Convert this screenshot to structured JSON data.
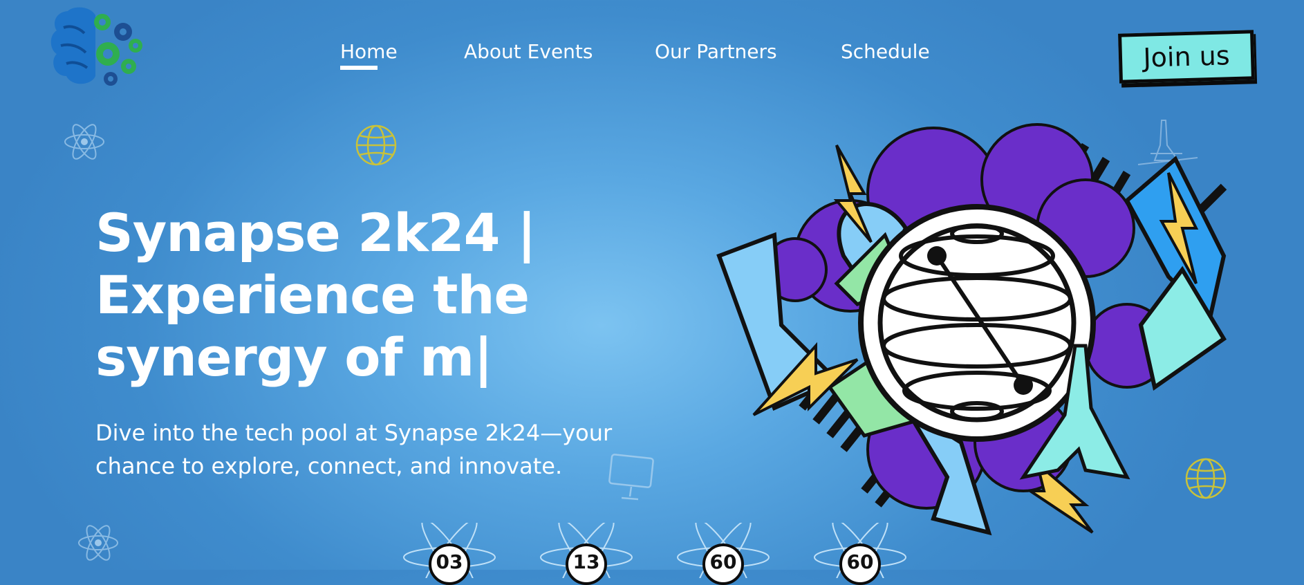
{
  "nav": {
    "items": [
      {
        "label": "Home",
        "active": true
      },
      {
        "label": "About Events",
        "active": false
      },
      {
        "label": "Our Partners",
        "active": false
      },
      {
        "label": "Schedule",
        "active": false
      }
    ],
    "join_label": "Join us"
  },
  "hero": {
    "title_lines": [
      "Synapse 2k24 |",
      "Experience the",
      "synergy of m|"
    ],
    "subtitle_lines": [
      "Dive into the tech pool at Synapse 2k24—your",
      "chance to explore, connect, and innovate."
    ]
  },
  "countdown": [
    "03",
    "13",
    "60",
    "60"
  ],
  "icons": {
    "logo": "brain-gears-logo",
    "decor": [
      "atom-icon",
      "globe-icon",
      "monitor-icon",
      "tower-icon"
    ],
    "illustration": "globe-arrows-illustration"
  },
  "colors": {
    "background": "#4a9ad8",
    "join_button": "#7fe8e4",
    "purple": "#6a2ec9",
    "lightblue": "#86cdf7",
    "yellow": "#f7cf55",
    "green": "#93e6a6"
  }
}
